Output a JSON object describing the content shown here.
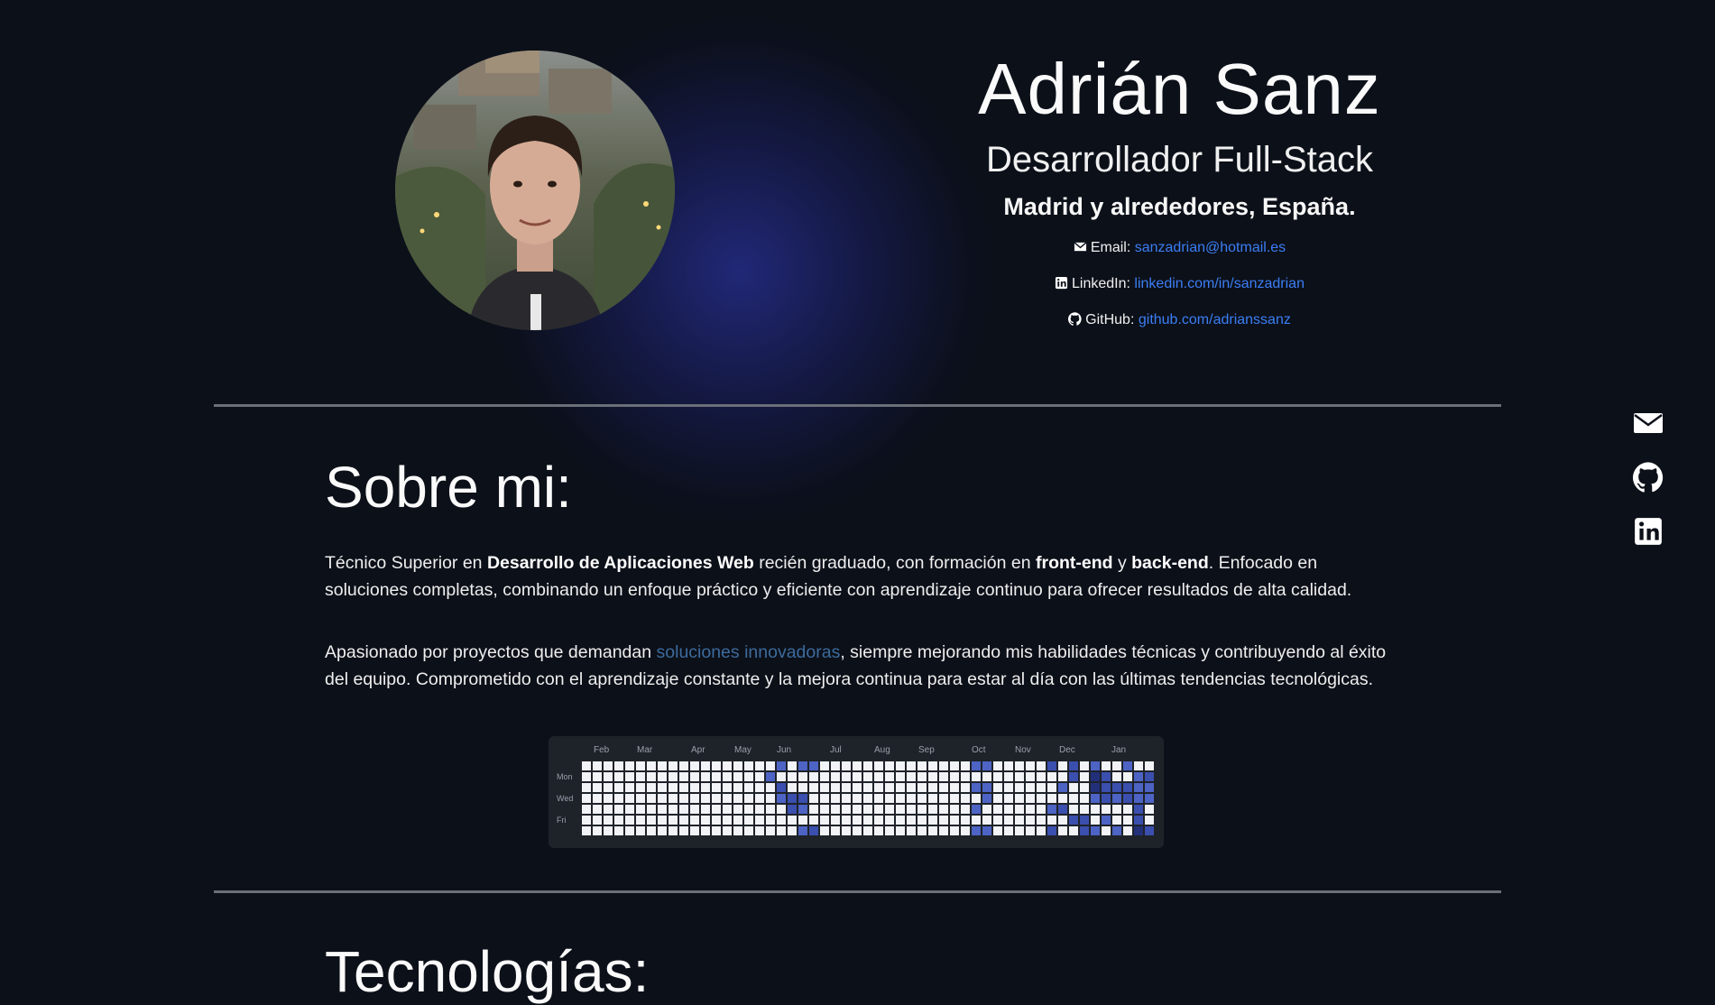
{
  "profile": {
    "name": "Adrián Sanz",
    "role": "Desarrollador Full-Stack",
    "location": "Madrid y alrededores, España.",
    "contacts": [
      {
        "icon": "envelope-icon",
        "label": "Email:",
        "value": "sanzadrian@hotmail.es"
      },
      {
        "icon": "linkedin-icon",
        "label": "LinkedIn:",
        "value": "linkedin.com/in/sanzadrian"
      },
      {
        "icon": "github-icon",
        "label": "GitHub:",
        "value": "github.com/adrianssanz"
      }
    ]
  },
  "side_nav": [
    "envelope-icon",
    "github-icon",
    "linkedin-icon"
  ],
  "about": {
    "title": "Sobre mi:",
    "p1": {
      "a": "Técnico Superior en ",
      "b": "Desarrollo de Aplicaciones Web",
      "c": " recién graduado, con formación en ",
      "d": "front-end",
      "e": " y ",
      "f": "back-end",
      "g": ". Enfocado en soluciones completas, combinando un enfoque práctico y eficiente con aprendizaje continuo para ofrecer resultados de alta calidad."
    },
    "p2": {
      "a": "Apasionado por proyectos que demandan ",
      "b": "soluciones innovadoras",
      "c": ", siempre mejorando mis habilidades técnicas y contribuyendo al éxito del equipo. Comprometido con el aprendizaje constante y la mejora continua para estar al día con las últimas tendencias tecnológicas."
    }
  },
  "contributions": {
    "months": [
      "Feb",
      "Mar",
      "Apr",
      "May",
      "Jun",
      "Jul",
      "Aug",
      "Sep",
      "Oct",
      "Nov",
      "Dec",
      "Jan"
    ],
    "days": [
      "Mon",
      "Wed",
      "Fri"
    ],
    "colors": {
      "empty": "#f2f3f7",
      "level1": "#4d64c4",
      "level2": "#3b4fae",
      "level3": "#22307a"
    }
  },
  "tech": {
    "title": "Tecnologías:"
  },
  "colors": {
    "background": "#0c1019",
    "link": "#3b7ef5",
    "divider": "#6b6f78"
  }
}
